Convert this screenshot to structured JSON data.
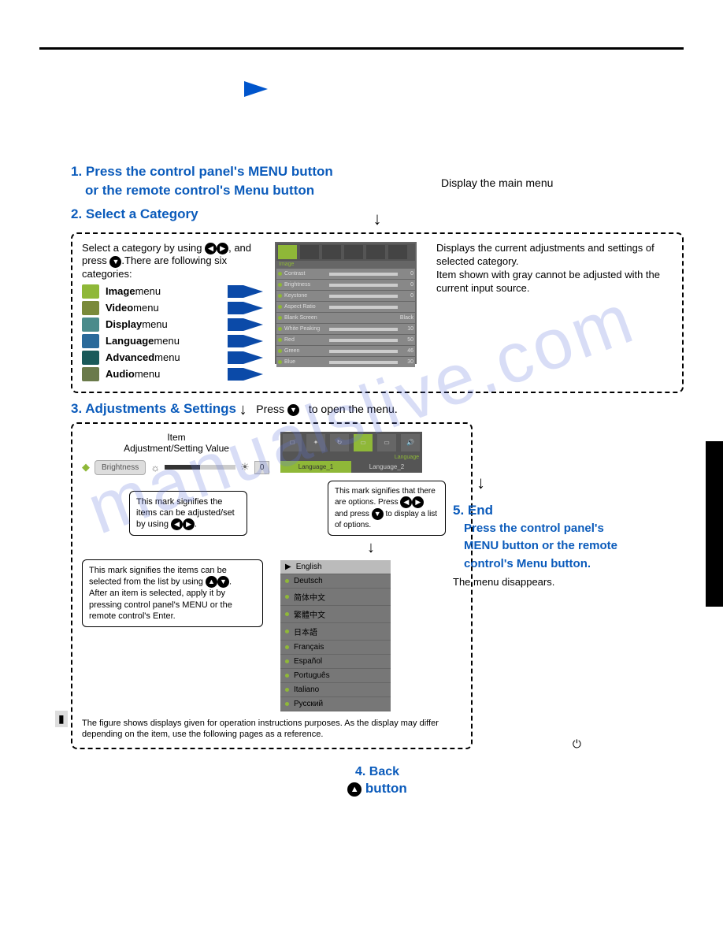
{
  "step1": {
    "title_line1": "1. Press the control panel's MENU button",
    "title_line2": "or the remote control's Menu button",
    "caption": "Display the main menu"
  },
  "step2": {
    "title": "2. Select a Category",
    "intro_a": "Select a category by using ",
    "intro_b": ", and press ",
    "intro_c": ".There are following six categories:",
    "menus": [
      {
        "label": "Image",
        "suffix": " menu"
      },
      {
        "label": "Video",
        "suffix": " menu"
      },
      {
        "label": "Display",
        "suffix": " menu"
      },
      {
        "label": "Language",
        "suffix": " menu"
      },
      {
        "label": "Advanced",
        "suffix": " menu"
      },
      {
        "label": "Audio",
        "suffix": " menu"
      }
    ],
    "right_text": "Displays the current adjustments and settings of selected category.\nItem shown with gray cannot be adjusted with the current input source."
  },
  "osd": {
    "tab_active": "Image",
    "rows": [
      {
        "label": "Contrast",
        "val": "0"
      },
      {
        "label": "Brightness",
        "val": "0"
      },
      {
        "label": "Keystone",
        "val": "0"
      },
      {
        "label": "Aspect Ratio",
        "val": ""
      },
      {
        "label": "Blank Screen",
        "val": "Black"
      },
      {
        "label": "White Peaking",
        "val": "10"
      },
      {
        "label": "Red",
        "val": "50"
      },
      {
        "label": "Green",
        "val": "46"
      },
      {
        "label": "Blue",
        "val": "30"
      }
    ]
  },
  "step3": {
    "title": "3. Adjustments & Settings",
    "press_text_a": "Press ",
    "press_text_b": " to open the menu.",
    "item_label": "Item",
    "adj_label": "Adjustment/Setting Value",
    "brightness_label": "Brightness",
    "brightness_val": "0",
    "note1": "This mark signifies the items can be adjusted/set by using ",
    "note2_a": "This mark signifies that there are options. Press ",
    "note2_b": " and press ",
    "note2_c": " to display a list of options.",
    "note3_a": "This mark signifies the items can be selected from the list by using ",
    "note3_b": ".\nAfter an item is selected, apply it by pressing control panel's MENU or the remote control's Enter.",
    "figure_note": "The figure shows displays given for operation instructions purposes. As the display may differ depending on the item, use the following pages as a reference."
  },
  "lang_panel": {
    "tab": "Language",
    "sub1": "Language_1",
    "sub2": "Language_2",
    "items": [
      "English",
      "Deutsch",
      "简体中文",
      "繁體中文",
      "日本語",
      "Français",
      "Español",
      "Português",
      "Italiano",
      "Русский"
    ]
  },
  "step4": {
    "title": "4. Back",
    "button_text": " button"
  },
  "step5": {
    "title": "5. End",
    "body": "Press the control panel's MENU button or the remote control's Menu button.",
    "disappears": "The menu disappears."
  },
  "watermark": "manualslive.com"
}
